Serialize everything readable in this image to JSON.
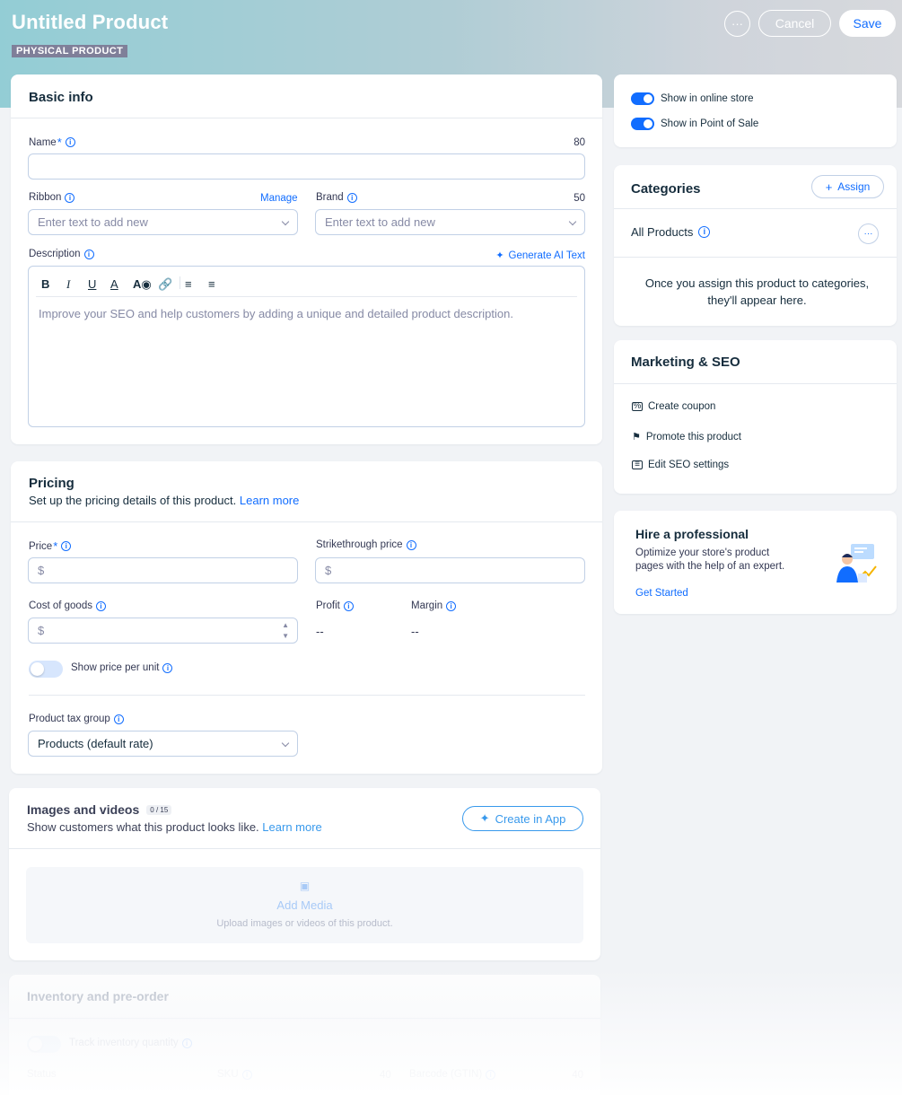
{
  "header": {
    "title": "Untitled Product",
    "badge": "PHYSICAL PRODUCT",
    "more_label": "···",
    "cancel_label": "Cancel",
    "save_label": "Save"
  },
  "basic_info": {
    "title": "Basic info",
    "name_label": "Name",
    "name_counter": "80",
    "ribbon_label": "Ribbon",
    "manage_label": "Manage",
    "ribbon_placeholder": "Enter text to add new",
    "brand_label": "Brand",
    "brand_counter": "50",
    "brand_placeholder": "Enter text to add new",
    "description_label": "Description",
    "generate_ai_label": "Generate AI Text",
    "description_placeholder": "Improve your SEO and help customers by adding a unique and detailed product description."
  },
  "pricing": {
    "title": "Pricing",
    "subtitle": "Set up the pricing details of this product.",
    "learn_more": "Learn more",
    "price_label": "Price",
    "price_prefix": "$",
    "strikethrough_label": "Strikethrough price",
    "strikethrough_prefix": "$",
    "cost_label": "Cost of goods",
    "cost_prefix": "$",
    "profit_label": "Profit",
    "profit_value": "--",
    "margin_label": "Margin",
    "margin_value": "--",
    "price_per_unit_label": "Show price per unit",
    "tax_group_label": "Product tax group",
    "tax_group_value": "Products (default rate)"
  },
  "media": {
    "title": "Images and videos",
    "count": "0 / 15",
    "subtitle": "Show customers what this product looks like.",
    "learn_more": "Learn more",
    "create_in_app": "Create in App",
    "add_media": "Add Media",
    "add_media_hint": "Upload images or videos of this product."
  },
  "inventory": {
    "title": "Inventory and pre-order",
    "track_label": "Track inventory quantity",
    "status_label": "Status",
    "sku_label": "SKU",
    "sku_counter": "40",
    "barcode_label": "Barcode (GTIN)",
    "barcode_counter": "40"
  },
  "visibility": {
    "online_store": "Show in online store",
    "pos": "Show in Point of Sale"
  },
  "categories": {
    "title": "Categories",
    "assign_label": "Assign",
    "all_products": "All Products",
    "empty_text": "Once you assign this product to categories, they'll appear here."
  },
  "marketing": {
    "title": "Marketing & SEO",
    "items": [
      "Create coupon",
      "Promote this product",
      "Edit SEO settings"
    ]
  },
  "hire": {
    "title": "Hire a professional",
    "text": "Optimize your store's product pages with the help of an expert.",
    "cta": "Get Started"
  },
  "colors": {
    "accent": "#116dff",
    "text": "#162d3d",
    "border": "#c1d0e6"
  }
}
